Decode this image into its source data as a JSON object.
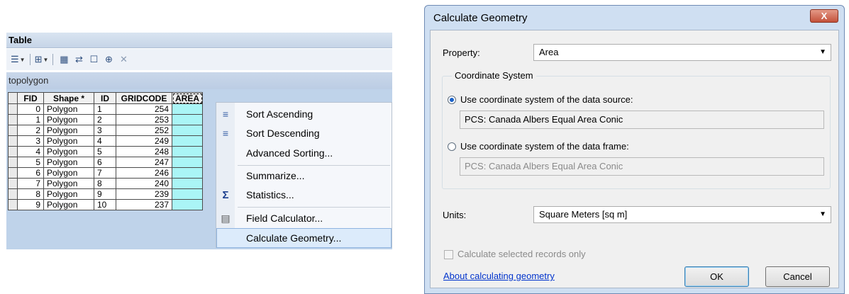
{
  "table": {
    "title": "Table",
    "tab": "topolygon",
    "toolbar": [
      "table-options-icon",
      "related-tables-icon",
      "select-by-attributes-icon",
      "switch-selection-icon",
      "clear-selection-icon",
      "zoom-to-selected-icon",
      "delete-selected-icon"
    ],
    "columns": [
      "FID",
      "Shape *",
      "ID",
      "GRIDCODE",
      "AREA"
    ],
    "rows": [
      {
        "fid": "0",
        "shape": "Polygon",
        "id": "1",
        "gridcode": "254"
      },
      {
        "fid": "1",
        "shape": "Polygon",
        "id": "2",
        "gridcode": "253"
      },
      {
        "fid": "2",
        "shape": "Polygon",
        "id": "3",
        "gridcode": "252"
      },
      {
        "fid": "3",
        "shape": "Polygon",
        "id": "4",
        "gridcode": "249"
      },
      {
        "fid": "4",
        "shape": "Polygon",
        "id": "5",
        "gridcode": "248"
      },
      {
        "fid": "5",
        "shape": "Polygon",
        "id": "6",
        "gridcode": "247"
      },
      {
        "fid": "6",
        "shape": "Polygon",
        "id": "7",
        "gridcode": "246"
      },
      {
        "fid": "7",
        "shape": "Polygon",
        "id": "8",
        "gridcode": "240"
      },
      {
        "fid": "8",
        "shape": "Polygon",
        "id": "9",
        "gridcode": "239"
      },
      {
        "fid": "9",
        "shape": "Polygon",
        "id": "10",
        "gridcode": "237"
      }
    ]
  },
  "context_menu": {
    "items": [
      {
        "label": "Sort Ascending",
        "icon": "sort-ascending-icon"
      },
      {
        "label": "Sort Descending",
        "icon": "sort-descending-icon"
      },
      {
        "label": "Advanced Sorting...",
        "icon": ""
      },
      {
        "label": "Summarize...",
        "icon": ""
      },
      {
        "label": "Statistics...",
        "icon": "sigma-icon"
      },
      {
        "label": "Field Calculator...",
        "icon": "calculator-icon"
      },
      {
        "label": "Calculate Geometry...",
        "icon": "",
        "highlighted": true
      }
    ]
  },
  "dialog": {
    "title": "Calculate Geometry",
    "close_label": "X",
    "property_label": "Property:",
    "property_value": "Area",
    "coord_group_label": "Coordinate System",
    "radio_source_label": "Use coordinate system of the data source:",
    "radio_source_value": "PCS: Canada Albers Equal Area Conic",
    "radio_frame_label": "Use coordinate system of the data frame:",
    "radio_frame_value": "PCS: Canada Albers Equal Area Conic",
    "units_label": "Units:",
    "units_value": "Square Meters [sq m]",
    "selected_only_label": "Calculate selected records only",
    "about_link": "About calculating geometry",
    "ok_label": "OK",
    "cancel_label": "Cancel"
  }
}
